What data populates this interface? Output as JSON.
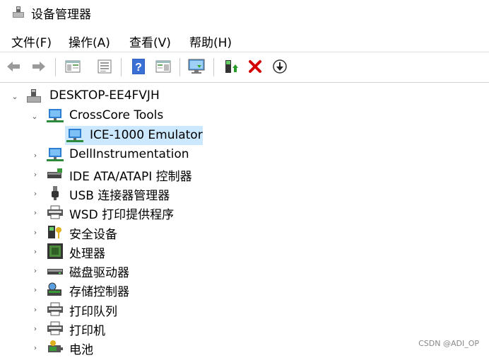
{
  "window": {
    "title": "设备管理器"
  },
  "menu": [
    "文件(F)",
    "操作(A)",
    "查看(V)",
    "帮助(H)"
  ],
  "toolbar": {
    "buttons": [
      "back-icon",
      "forward-icon",
      "properties-panel-icon",
      "document-icon",
      "help-icon",
      "details-pane-icon",
      "monitor-scan-icon",
      "update-driver-icon",
      "remove-device-icon",
      "download-icon"
    ],
    "colors": {
      "remove": "#d40000",
      "help": "#2f5fbf"
    }
  },
  "tree": {
    "root": "DESKTOP-EE4FVJH",
    "items": [
      {
        "label": "CrossCore Tools",
        "expanded": true,
        "icon": "network-monitor-icon",
        "children": [
          {
            "label": "ICE-1000 Emulator",
            "icon": "network-monitor-icon",
            "selected": true
          }
        ]
      },
      {
        "label": "DellInstrumentation",
        "icon": "network-monitor-icon"
      },
      {
        "label": "IDE ATA/ATAPI 控制器",
        "icon": "ide-controller-icon"
      },
      {
        "label": "USB 连接器管理器",
        "icon": "usb-connector-icon"
      },
      {
        "label": "WSD 打印提供程序",
        "icon": "printer-icon"
      },
      {
        "label": "安全设备",
        "icon": "security-key-icon"
      },
      {
        "label": "处理器",
        "icon": "cpu-icon"
      },
      {
        "label": "磁盘驱动器",
        "icon": "disk-drive-icon"
      },
      {
        "label": "存储控制器",
        "icon": "storage-controller-icon"
      },
      {
        "label": "打印队列",
        "icon": "printer-icon"
      },
      {
        "label": "打印机",
        "icon": "printer-icon"
      },
      {
        "label": "电池",
        "icon": "battery-icon"
      }
    ]
  },
  "watermark": "CSDN @ADI_OP",
  "colors": {
    "selection": "#cce8ff",
    "monitor": "#2d7fd3"
  }
}
